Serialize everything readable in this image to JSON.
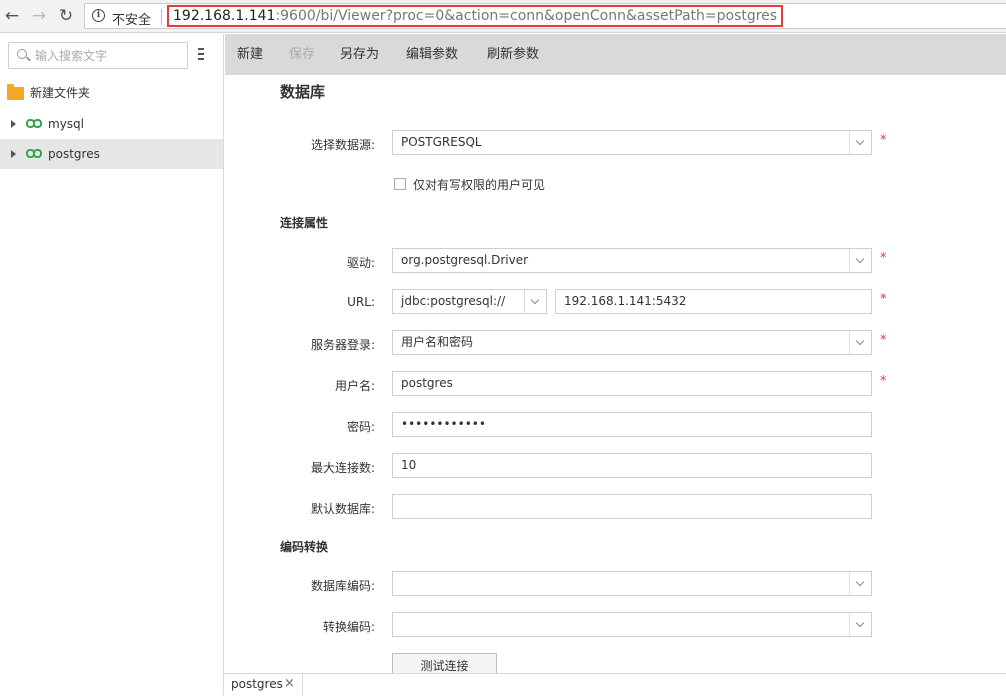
{
  "browser": {
    "insecure_label": "不安全",
    "url_host": "192.168.1.141",
    "url_rest": ":9600/bi/Viewer?proc=0&action=conn&openConn&assetPath=postgres",
    "icons": [
      "back-arrow-icon",
      "forward-arrow-icon",
      "reload-icon",
      "info-icon"
    ]
  },
  "sidebar": {
    "search_placeholder": "输入搜索文字",
    "items": [
      {
        "label": "新建文件夹",
        "icon": "folder-icon"
      },
      {
        "label": "mysql",
        "icon": "link-icon"
      },
      {
        "label": "postgres",
        "icon": "link-icon",
        "selected": true
      }
    ]
  },
  "toolbar": {
    "new": "新建",
    "save": "保存",
    "save_as": "另存为",
    "edit_params": "编辑参数",
    "refresh_params": "刷新参数"
  },
  "form": {
    "title": "数据库",
    "datasource_label": "选择数据源:",
    "datasource_value": "POSTGRESQL",
    "checkbox_label": "仅对有写权限的用户可见",
    "conn_section": "连接属性",
    "driver_label": "驱动:",
    "driver_value": "org.postgresql.Driver",
    "url_label": "URL:",
    "url_prefix": "jdbc:postgresql://",
    "url_host": "192.168.1.141:5432",
    "login_label": "服务器登录:",
    "login_value": "用户名和密码",
    "user_label": "用户名:",
    "user_value": "postgres",
    "password_label": "密码:",
    "password_value": "••••••••••••",
    "maxconn_label": "最大连接数:",
    "maxconn_value": "10",
    "defaultdb_label": "默认数据库:",
    "defaultdb_value": "",
    "encoding_section": "编码转换",
    "dbencoding_label": "数据库编码:",
    "dbencoding_value": "",
    "convencoding_label": "转换编码:",
    "convencoding_value": "",
    "required_mark": "*",
    "test_button": "测试连接"
  },
  "tabs": [
    {
      "label": "postgres",
      "close": "×"
    }
  ]
}
